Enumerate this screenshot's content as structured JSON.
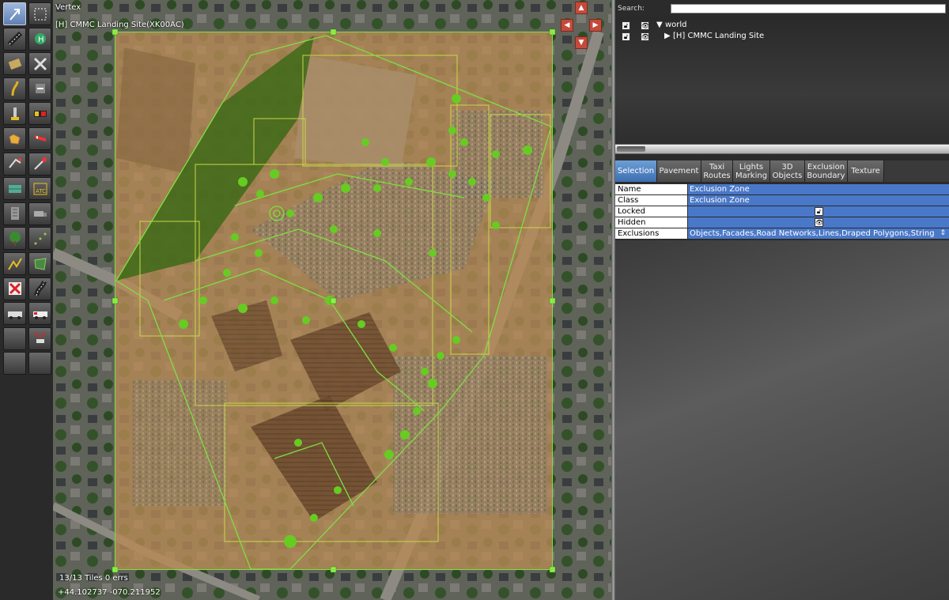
{
  "map": {
    "tool_label": "Vertex",
    "selection_label": "[H] CMMC Landing Site(XK00AC)",
    "status_tiles": "13/13 Tiles 0 errs",
    "status_coords": "+44.102737 -070.211952"
  },
  "toolbar": {
    "tools": [
      {
        "icon": "arrow-select-icon"
      },
      {
        "icon": "marquee-icon"
      },
      {
        "icon": "runway-icon"
      },
      {
        "icon": "helipad-icon"
      },
      {
        "icon": "sealane-icon"
      },
      {
        "icon": "taxiway-icon"
      },
      {
        "icon": "taxiline-icon"
      },
      {
        "icon": "ramp-start-icon"
      },
      {
        "icon": "light-fixture-icon"
      },
      {
        "icon": "sign-icon"
      },
      {
        "icon": "boundary-icon"
      },
      {
        "icon": "windsock-icon"
      },
      {
        "icon": "tower-viewpoint-icon"
      },
      {
        "icon": "beacon-icon"
      },
      {
        "icon": "facade-icon"
      },
      {
        "icon": "atc-icon"
      },
      {
        "icon": "building-icon"
      },
      {
        "icon": "truck-icon"
      },
      {
        "icon": "tree-icon"
      },
      {
        "icon": "point-line-icon"
      },
      {
        "icon": "line-icon"
      },
      {
        "icon": "polygon-icon"
      },
      {
        "icon": "exclusion-icon"
      },
      {
        "icon": "road-icon"
      },
      {
        "icon": "ground-vehicle-icon"
      },
      {
        "icon": "fuel-truck-icon"
      },
      {
        "icon": "empty-tool-icon"
      },
      {
        "icon": "flag-icon"
      },
      {
        "icon": "empty-tool-icon"
      },
      {
        "icon": "empty-tool-icon"
      }
    ]
  },
  "panel": {
    "search_label": "Search:",
    "search_value": "",
    "tree": [
      {
        "label": "world",
        "expander": "▼"
      },
      {
        "label": "[H] CMMC Landing Site",
        "expander": "▶"
      }
    ],
    "tabs": [
      {
        "label": "Selection"
      },
      {
        "label": "Pavement"
      },
      {
        "label": "Taxi\nRoutes"
      },
      {
        "label": "Lights\nMarking"
      },
      {
        "label": "3D\nObjects"
      },
      {
        "label": "Exclusion\nBoundary"
      },
      {
        "label": "Texture"
      }
    ],
    "properties": [
      {
        "name": "Name",
        "value": "Exclusion Zone"
      },
      {
        "name": "Class",
        "value": "Exclusion Zone"
      },
      {
        "name": "Locked",
        "value": ""
      },
      {
        "name": "Hidden",
        "value": ""
      },
      {
        "name": "Exclusions",
        "value": "Objects,Facades,Road Networks,Lines,Draped Polygons,String"
      }
    ]
  },
  "colors": {
    "selection_green": "#7ee040",
    "tab_active": "#4f84c8",
    "property_value_bg": "#4a78c8"
  }
}
